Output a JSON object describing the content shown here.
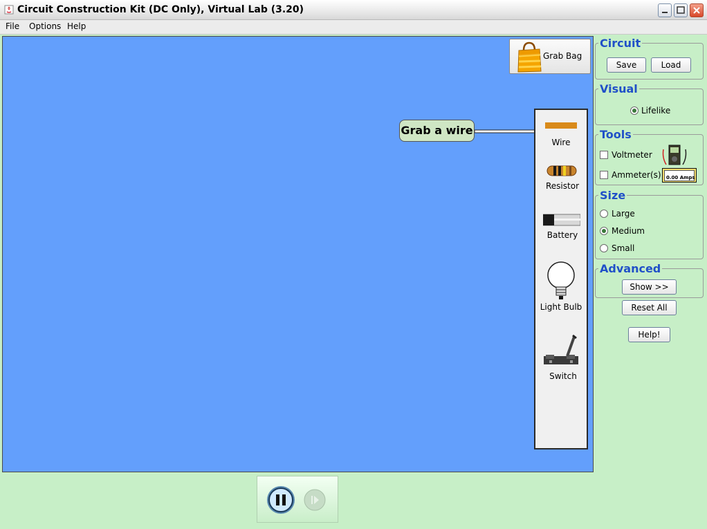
{
  "window": {
    "title": "Circuit Construction Kit (DC Only), Virtual Lab (3.20)"
  },
  "menu": [
    "File",
    "Options",
    "Help"
  ],
  "grab_bag": {
    "label": "Grab Bag"
  },
  "hint": {
    "text": "Grab a wire"
  },
  "toolbox": {
    "items": [
      {
        "label": "Wire",
        "icon": "wire-icon"
      },
      {
        "label": "Resistor",
        "icon": "resistor-icon"
      },
      {
        "label": "Battery",
        "icon": "battery-icon"
      },
      {
        "label": "Light Bulb",
        "icon": "light-bulb-icon"
      },
      {
        "label": "Switch",
        "icon": "switch-icon"
      }
    ]
  },
  "panel": {
    "circuit": {
      "title": "Circuit",
      "save": "Save",
      "load": "Load"
    },
    "visual": {
      "title": "Visual",
      "option": "Lifelike",
      "selected": true
    },
    "tools": {
      "title": "Tools",
      "voltmeter": "Voltmeter",
      "ammeter": "Ammeter(s)",
      "ammeter_readout": "0.00 Amps"
    },
    "size": {
      "title": "Size",
      "options": [
        "Large",
        "Medium",
        "Small"
      ],
      "selected": "Medium"
    },
    "advanced": {
      "title": "Advanced",
      "show": "Show >>"
    },
    "reset_all": "Reset All",
    "help": "Help!"
  },
  "colors": {
    "canvas": "#639ffc",
    "panel_bg": "#c7efc7",
    "group_title": "#2050c8",
    "wire": "#d98a1a"
  }
}
